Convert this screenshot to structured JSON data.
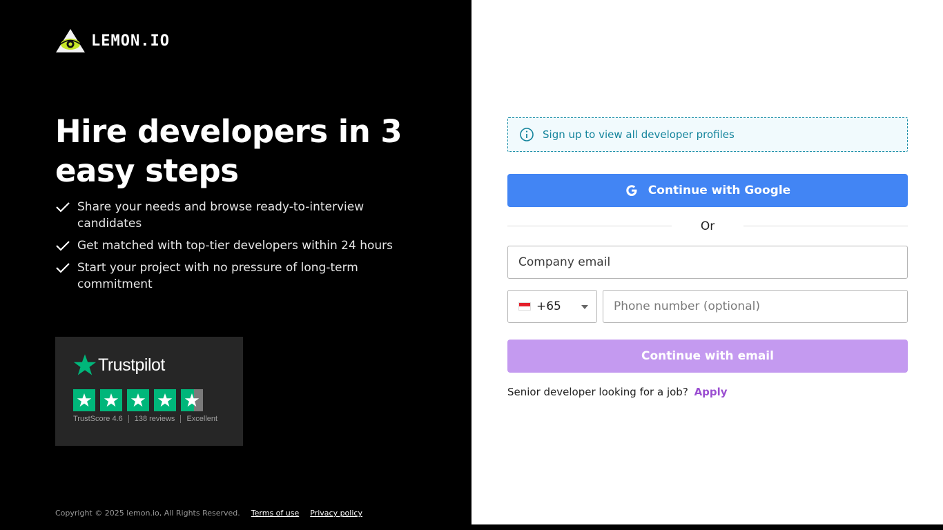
{
  "brand": {
    "logo_text": "LEMON.IO"
  },
  "hero": {
    "headline": "Hire developers in 3 easy steps",
    "benefits": [
      "Share your needs and browse ready-to-interview candidates",
      "Get matched with top-tier developers within 24 hours",
      "Start your project with no pressure of long-term commitment"
    ]
  },
  "trustpilot": {
    "name": "Trustpilot",
    "trustscore": "TrustScore 4.6",
    "reviews": "138 reviews",
    "rating_word": "Excellent",
    "stars_value": 4.6,
    "stars_max": 5
  },
  "footer": {
    "copyright": "Copyright © 2025 lemon.io, All Rights Reserved.",
    "terms": "Terms of use",
    "privacy": "Privacy policy"
  },
  "signup": {
    "notice": "Sign up to view all developer profiles",
    "google_button": "Continue with Google",
    "or": "Or",
    "email_placeholder": "Company email",
    "country_code": "+65",
    "phone_placeholder": "Phone number (optional)",
    "email_button": "Continue with email",
    "job_prompt": "Senior developer looking for a job?",
    "apply_link": "Apply"
  },
  "colors": {
    "google_blue": "#4285f4",
    "email_button": "#c49af0",
    "trustpilot_green": "#00b67a",
    "notice_text": "#14849c",
    "apply_link": "#9b4fd1"
  }
}
